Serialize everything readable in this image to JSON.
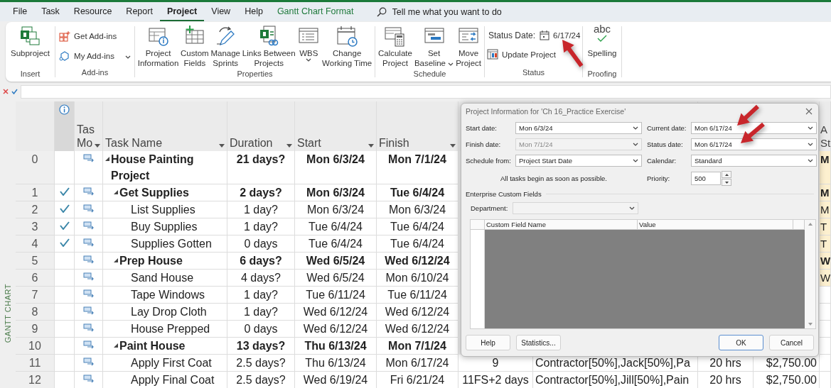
{
  "menu_tabs": [
    {
      "label": "File",
      "selected": false,
      "kind": "tab"
    },
    {
      "label": "Task",
      "selected": false,
      "kind": "tab"
    },
    {
      "label": "Resource",
      "selected": false,
      "kind": "tab"
    },
    {
      "label": "Report",
      "selected": false,
      "kind": "tab"
    },
    {
      "label": "Project",
      "selected": true,
      "kind": "tab"
    },
    {
      "label": "View",
      "selected": false,
      "kind": "tab"
    },
    {
      "label": "Help",
      "selected": false,
      "kind": "tab"
    },
    {
      "label": "Gantt Chart Format",
      "selected": false,
      "kind": "contextual"
    }
  ],
  "search": {
    "placeholder": "Tell me what you want to do"
  },
  "ribbon": {
    "groups": [
      {
        "label": "Insert",
        "items": [
          {
            "kind": "large",
            "lines": [
              "Subproject"
            ],
            "dropdown": false
          }
        ]
      },
      {
        "label": "Add-ins",
        "items": [
          {
            "kind": "small",
            "lines": [
              "Get Add-ins"
            ],
            "dropdown": false
          },
          {
            "kind": "small",
            "lines": [
              "My Add-ins"
            ],
            "dropdown": true
          }
        ]
      },
      {
        "label": "Properties",
        "items": [
          {
            "kind": "large",
            "lines": [
              "Project",
              "Information"
            ],
            "dropdown": false
          },
          {
            "kind": "large",
            "lines": [
              "Custom",
              "Fields"
            ],
            "dropdown": false
          },
          {
            "kind": "large",
            "lines": [
              "Manage",
              "Sprints"
            ],
            "dropdown": false
          },
          {
            "kind": "large",
            "lines": [
              "Links Between",
              "Projects"
            ],
            "dropdown": false
          },
          {
            "kind": "large",
            "lines": [
              "WBS"
            ],
            "dropdown": true
          },
          {
            "kind": "large",
            "lines": [
              "Change",
              "Working Time"
            ],
            "dropdown": false
          }
        ]
      },
      {
        "label": "Schedule",
        "items": [
          {
            "kind": "large",
            "lines": [
              "Calculate",
              "Project"
            ],
            "dropdown": false
          },
          {
            "kind": "large",
            "lines": [
              "Set",
              "Baseline"
            ],
            "dropdown": true
          },
          {
            "kind": "large",
            "lines": [
              "Move",
              "Project"
            ],
            "dropdown": false
          }
        ]
      },
      {
        "label": "Status",
        "items": [
          {
            "kind": "date",
            "label": "Status Date:",
            "value": "6/17/24"
          },
          {
            "kind": "small",
            "lines": [
              "Update Project"
            ],
            "dropdown": false
          }
        ]
      },
      {
        "label": "Proofing",
        "items": [
          {
            "kind": "large",
            "lines": [
              "Spelling"
            ],
            "icon_text": "abc",
            "dropdown": false
          }
        ]
      }
    ]
  },
  "side_label": "GANTT CHART",
  "table": {
    "columns": [
      {
        "kind": "indicators"
      },
      {
        "kind": "text",
        "lines": [
          "Tas",
          "Mo"
        ],
        "filter": true
      },
      {
        "kind": "text",
        "lines": [
          "Task Name"
        ],
        "filter": true
      },
      {
        "kind": "text",
        "lines": [
          "Duration"
        ],
        "filter": true
      },
      {
        "kind": "text",
        "lines": [
          "Start"
        ],
        "filter": true
      },
      {
        "kind": "text",
        "lines": [
          "Finish"
        ],
        "filter": true
      },
      {
        "kind": "text",
        "lines": [
          "A",
          "St"
        ]
      }
    ],
    "rows": [
      {
        "id": "0",
        "name": "House Painting Project",
        "duration": "21 days?",
        "start": "Mon 6/3/24",
        "finish": "Mon 7/1/24",
        "complete": false,
        "expanded": true,
        "column_13": "M",
        "children": [
          {
            "id": "1",
            "name": "Get Supplies",
            "duration": "2 days?",
            "start": "Mon 6/3/24",
            "finish": "Tue 6/4/24",
            "complete": true,
            "expanded": true,
            "column_13": "M",
            "children": [
              {
                "id": "2",
                "name": "List Supplies",
                "duration": "1 day?",
                "start": "Mon 6/3/24",
                "finish": "Mon 6/3/24",
                "complete": true,
                "column_13": "M"
              },
              {
                "id": "3",
                "name": "Buy Supplies",
                "duration": "1 day?",
                "start": "Tue 6/4/24",
                "finish": "Tue 6/4/24",
                "complete": true,
                "column_13": "T"
              },
              {
                "id": "4",
                "name": "Supplies Gotten",
                "duration": "0 days",
                "start": "Tue 6/4/24",
                "finish": "Tue 6/4/24",
                "complete": true,
                "column_13": "T"
              }
            ]
          },
          {
            "id": "5",
            "name": "Prep House",
            "duration": "6 days?",
            "start": "Wed 6/5/24",
            "finish": "Wed 6/12/24",
            "complete": false,
            "expanded": true,
            "column_13": "W",
            "children": [
              {
                "id": "6",
                "name": "Sand House",
                "duration": "4 days?",
                "start": "Wed 6/5/24",
                "finish": "Mon 6/10/24",
                "complete": false,
                "column_13": "W"
              },
              {
                "id": "7",
                "name": "Tape Windows",
                "duration": "1 day?",
                "start": "Tue 6/11/24",
                "finish": "Tue 6/11/24",
                "complete": false
              },
              {
                "id": "8",
                "name": "Lay Drop Cloth",
                "duration": "1 day?",
                "start": "Wed 6/12/24",
                "finish": "Wed 6/12/24",
                "complete": false
              },
              {
                "id": "9",
                "name": "House Prepped",
                "duration": "0 days",
                "start": "Wed 6/12/24",
                "finish": "Wed 6/12/24",
                "complete": false
              }
            ]
          },
          {
            "id": "10",
            "name": "Paint House",
            "duration": "13 days?",
            "start": "Thu 6/13/24",
            "finish": "Mon 7/1/24",
            "complete": false,
            "expanded": true,
            "children": [
              {
                "id": "11",
                "name": "Apply First Coat",
                "duration": "2.5 days?",
                "start": "Thu 6/13/24",
                "finish": "Mon 6/17/24",
                "complete": false,
                "column_9": "9",
                "column_10": "Contractor[50%],Jack[50%],Pa",
                "column_11": "20 hrs",
                "column_12": "$2,750.00"
              },
              {
                "id": "12",
                "name": "Apply Final Coat",
                "duration": "2.5 days?",
                "start": "Wed 6/19/24",
                "finish": "Fri 6/21/24",
                "complete": false,
                "column_9": "11FS+2 days",
                "column_10": "Contractor[50%],Jill[50%],Pain",
                "column_11": "20 hrs",
                "column_12": "$2,750.00"
              }
            ]
          }
        ]
      }
    ]
  },
  "dialog": {
    "title": "Project Information for 'Ch 16_Practice Exercise'",
    "fields": [
      {
        "label": "Start date:",
        "value": "Mon 6/3/24",
        "disabled": false
      },
      {
        "label": "Current date:",
        "value": "Mon 6/17/24",
        "disabled": false
      },
      {
        "label": "Finish date:",
        "value": "Mon 7/1/24",
        "disabled": true
      },
      {
        "label": "Status date:",
        "value": "Mon 6/17/24",
        "disabled": false
      },
      {
        "label": "Schedule from:",
        "value": "Project Start Date",
        "disabled": false
      },
      {
        "label": "Calendar:",
        "value": "Standard",
        "disabled": false
      }
    ],
    "note": "All tasks begin as soon as possible.",
    "priority": {
      "label": "Priority:",
      "value": "500"
    },
    "section": "Enterprise Custom Fields",
    "department": {
      "label": "Department:",
      "disabled": true
    },
    "grid_columns": [
      "Custom Field Name",
      "Value"
    ],
    "buttons": [
      {
        "label": "Help",
        "default": false
      },
      {
        "label": "Statistics...",
        "default": false
      },
      {
        "label": "OK",
        "default": true
      },
      {
        "label": "Cancel",
        "default": false
      }
    ]
  }
}
